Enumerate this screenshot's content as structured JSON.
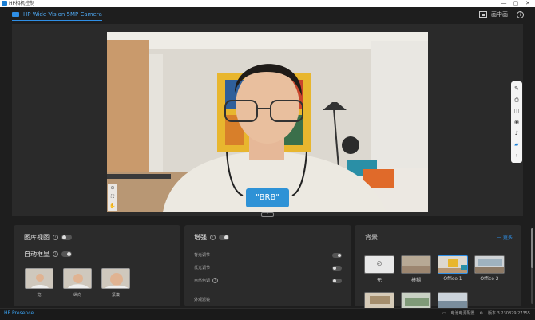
{
  "window": {
    "app_name": "HP相机控制",
    "minimize": "—",
    "maximize": "▢",
    "close": "✕"
  },
  "header": {
    "camera_tab": "HP Wide Vision 5MP Camera",
    "pip_label": "画中画",
    "info": "i"
  },
  "preview": {
    "overlay_text": "\"BRB\"",
    "collapse": "⌃"
  },
  "panel_left": {
    "gallery_view": "图库视图",
    "auto_frame": "自动框显",
    "thumbs": [
      "宽",
      "纵向",
      "紧凑"
    ]
  },
  "panel_mid": {
    "enhance": "增强",
    "rows": [
      "背光调节",
      "低光调节",
      "自然色调"
    ],
    "filter_label": "外观滤镜"
  },
  "panel_right": {
    "title": "背景",
    "link": "一 更多",
    "items": [
      "无",
      "模糊",
      "Office 1",
      "Office 2"
    ]
  },
  "status": {
    "brand": "HP Presence",
    "right_text": "电池电源配置",
    "version": "版本 3.230829.27355"
  },
  "colors": {
    "accent": "#2f8fe6",
    "brb": "#2e92d6",
    "background": "#1e1e1e",
    "panel": "#2b2b2b"
  }
}
